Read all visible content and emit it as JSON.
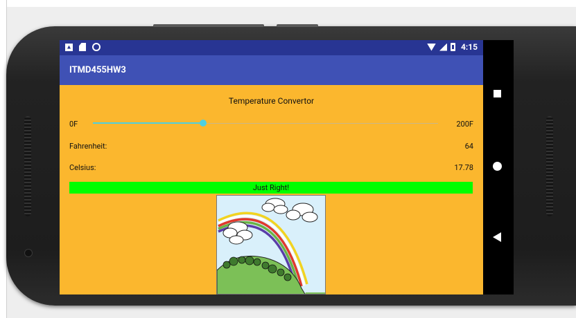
{
  "status_bar": {
    "time": "4:15",
    "left_icons": [
      "android-notification-icon",
      "sd-card-icon",
      "circle-notification-icon"
    ],
    "right_icons": [
      "wifi-icon",
      "signal-icon",
      "battery-icon"
    ]
  },
  "app_bar": {
    "title": "ITMD455HW3"
  },
  "content": {
    "heading": "Temperature Convertor",
    "slider": {
      "min_label": "0F",
      "max_label": "200F",
      "value": 64,
      "min": 0,
      "max": 200
    },
    "fahrenheit": {
      "label": "Fahrenheit:",
      "value": "64"
    },
    "celsius": {
      "label": "Celsius:",
      "value": "17.78"
    },
    "status": {
      "text": "Just Right!",
      "color": "#00ff00"
    },
    "image": {
      "icon": "rainbow-landscape-image"
    }
  },
  "navigation_bar": {
    "icons": [
      "recent-apps-icon",
      "home-icon",
      "back-icon"
    ]
  },
  "colors": {
    "status_bar": "#283593",
    "app_bar": "#3f51b5",
    "background": "#fbb72e",
    "accent": "#4dd0e1"
  }
}
